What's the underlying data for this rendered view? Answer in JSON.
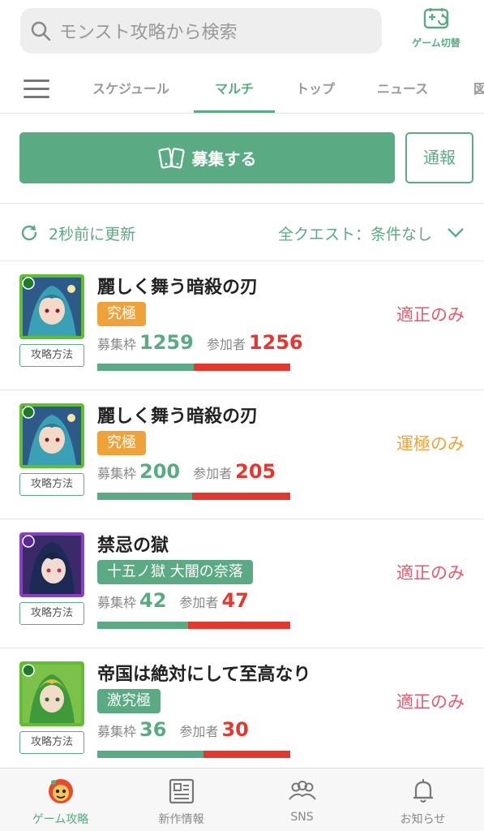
{
  "search": {
    "placeholder": "モンスト攻略から検索"
  },
  "game_switch": {
    "label": "ゲーム切替",
    "icon": "gamepad-switch-icon"
  },
  "tabs": [
    {
      "label": "スケジュール",
      "active": false
    },
    {
      "label": "マルチ",
      "active": true
    },
    {
      "label": "トップ",
      "active": false
    },
    {
      "label": "ニュース",
      "active": false
    },
    {
      "label": "図",
      "active": false
    }
  ],
  "actions": {
    "recruit_label": "募集する",
    "report_label": "通報"
  },
  "refresh": {
    "label": "2秒前に更新"
  },
  "filter": {
    "label": "全クエスト：条件なし"
  },
  "labels": {
    "slots": "募集枠",
    "participants": "参加者",
    "howto": "攻略方法"
  },
  "rows": [
    {
      "name": "麗しく舞う暗殺の刃",
      "tag": "究極",
      "tag_color": "#f0a23a",
      "slots": "1259",
      "participants": "1256",
      "condition": "適正のみ",
      "condition_color": "#e8586a",
      "fill": 0.5
    },
    {
      "name": "麗しく舞う暗殺の刃",
      "tag": "究極",
      "tag_color": "#f0a23a",
      "slots": "200",
      "participants": "205",
      "condition": "運極のみ",
      "condition_color": "#f0a23a",
      "fill": 0.49
    },
    {
      "name": "禁忌の獄",
      "tag": "十五ノ獄 大闇の奈落",
      "tag_color": "#5aaa84",
      "slots": "42",
      "participants": "47",
      "condition": "適正のみ",
      "condition_color": "#e8586a",
      "fill": 0.47
    },
    {
      "name": "帝国は絶対にして至高なり",
      "tag": "激究極",
      "tag_color": "#5aaa84",
      "slots": "36",
      "participants": "30",
      "condition": "適正のみ",
      "condition_color": "#e8586a",
      "fill": 0.55
    }
  ],
  "bottom_nav": [
    {
      "label": "ゲーム攻略",
      "icon": "monster-mascot-icon",
      "active": true
    },
    {
      "label": "新作情報",
      "icon": "news-icon",
      "active": false
    },
    {
      "label": "SNS",
      "icon": "people-icon",
      "active": false
    },
    {
      "label": "お知らせ",
      "icon": "bell-icon",
      "active": false
    }
  ],
  "colors": {
    "accent": "#5aaa84",
    "red": "#e6372e",
    "orange": "#f0a23a",
    "pink": "#e8586a"
  }
}
